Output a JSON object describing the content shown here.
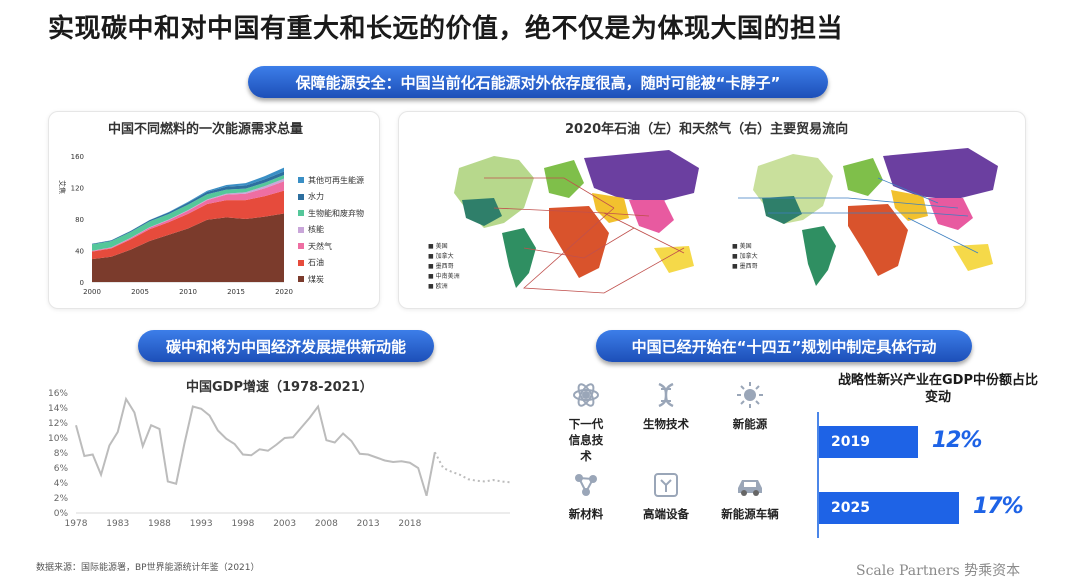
{
  "title": "实现碳中和对中国有重大和长远的价值，绝不仅是为体现大国的担当",
  "banner1": "保障能源安全：中国当前化石能源对外依存度很高，随时可能被“卡脖子”",
  "banner2": "碳中和将为中国经济发展提供新动能",
  "banner3": "中国已经开始在“十四五”规划中制定具体行动",
  "map_title": "2020年石油（左）和天然气（右）主要贸易流向",
  "industries": [
    {
      "label": "下一代信息技术",
      "icon": "atom-icon"
    },
    {
      "label": "生物技术",
      "icon": "dna-icon"
    },
    {
      "label": "新能源",
      "icon": "sun-icon"
    },
    {
      "label": "新材料",
      "icon": "molecule-icon"
    },
    {
      "label": "高端设备",
      "icon": "circuit-icon"
    },
    {
      "label": "新能源车辆",
      "icon": "car-icon"
    }
  ],
  "share": {
    "title": "战略性新兴产业在GDP中份额占比变动",
    "rows": [
      {
        "year": "2019",
        "value": 12,
        "label": "12%"
      },
      {
        "year": "2025",
        "value": 17,
        "label": "17%"
      }
    ]
  },
  "source": "数据来源：国际能源署，BP世界能源统计年鉴（2021）",
  "brand": "Scale Partners 势乘资本",
  "colors": {
    "accent": "#1e63e6",
    "pill": "#2b63d1"
  },
  "chart_data": [
    {
      "type": "area",
      "stacked": true,
      "title": "中国不同燃料的一次能源需求总量",
      "ylabel": "艾焦",
      "x": [
        2000,
        2002,
        2004,
        2006,
        2008,
        2010,
        2012,
        2014,
        2016,
        2018,
        2020
      ],
      "xticks": [
        2000,
        2005,
        2010,
        2015,
        2020
      ],
      "yticks": [
        0,
        40,
        80,
        120,
        160
      ],
      "ylim": [
        0,
        160
      ],
      "legend_position": "right",
      "series": [
        {
          "name": "煤炭",
          "color": "#7b3b2c",
          "values": [
            29,
            32,
            41,
            52,
            60,
            68,
            79,
            82,
            80,
            83,
            87
          ]
        },
        {
          "name": "石油",
          "color": "#e64b3c",
          "values": [
            9.5,
            10.5,
            13,
            15,
            16,
            18.5,
            20,
            22,
            24,
            26,
            29
          ]
        },
        {
          "name": "天然气",
          "color": "#ee6ea2",
          "values": [
            1,
            1.1,
            1.5,
            2,
            2.8,
            4,
            5,
            7,
            8,
            10,
            12
          ]
        },
        {
          "name": "核能",
          "color": "#c9a6d9",
          "values": [
            0.2,
            0.3,
            0.4,
            0.5,
            0.6,
            0.8,
            0.9,
            1.3,
            2,
            2.7,
            3.3
          ]
        },
        {
          "name": "生物能和废弃物",
          "color": "#55c79a",
          "values": [
            8,
            8,
            7.5,
            7.5,
            7,
            7,
            6.5,
            5,
            4.5,
            4.5,
            4.5
          ]
        },
        {
          "name": "水力",
          "color": "#2d6f9f",
          "values": [
            0.8,
            1,
            1.2,
            1.5,
            2,
            2.5,
            3,
            3.8,
            4,
            4.2,
            4.5
          ]
        },
        {
          "name": "其他可再生能源",
          "color": "#3a8fc5",
          "values": [
            0.1,
            0.1,
            0.2,
            0.3,
            0.5,
            0.9,
            1.4,
            2,
            3,
            4,
            5
          ]
        }
      ]
    },
    {
      "type": "line",
      "title": "中国GDP增速（1978-2021）",
      "x": [
        1978,
        1979,
        1980,
        1981,
        1982,
        1983,
        1984,
        1985,
        1986,
        1987,
        1988,
        1989,
        1990,
        1991,
        1992,
        1993,
        1994,
        1995,
        1996,
        1997,
        1998,
        1999,
        2000,
        2001,
        2002,
        2003,
        2004,
        2005,
        2006,
        2007,
        2008,
        2009,
        2010,
        2011,
        2012,
        2013,
        2014,
        2015,
        2016,
        2017,
        2018,
        2019,
        2020,
        2021
      ],
      "xticks": [
        1978,
        1983,
        1988,
        1993,
        1998,
        2003,
        2008,
        2013,
        2018
      ],
      "yticks": [
        "0%",
        "2%",
        "4%",
        "6%",
        "8%",
        "10%",
        "12%",
        "14%",
        "16%"
      ],
      "ylim": [
        0,
        16
      ],
      "grid": false,
      "series": [
        {
          "values": [
            11.7,
            7.6,
            7.8,
            5.1,
            9.0,
            10.8,
            15.2,
            13.4,
            8.9,
            11.7,
            11.2,
            4.2,
            3.9,
            9.3,
            14.2,
            13.9,
            13.0,
            11.0,
            9.9,
            9.2,
            7.8,
            7.7,
            8.5,
            8.3,
            9.1,
            10.0,
            10.1,
            11.4,
            12.7,
            14.2,
            9.7,
            9.4,
            10.6,
            9.6,
            7.9,
            7.8,
            7.4,
            7.0,
            6.8,
            6.9,
            6.7,
            6.0,
            2.3,
            8.1
          ]
        },
        {
          "style": "dotted",
          "x": [
            2021,
            2022,
            2023,
            2024,
            2025,
            2026,
            2027,
            2028,
            2029,
            2030
          ],
          "values": [
            8.1,
            6.0,
            5.5,
            5.1,
            4.5,
            4.3,
            4.2,
            4.4,
            4.2,
            4.1
          ]
        }
      ]
    }
  ]
}
